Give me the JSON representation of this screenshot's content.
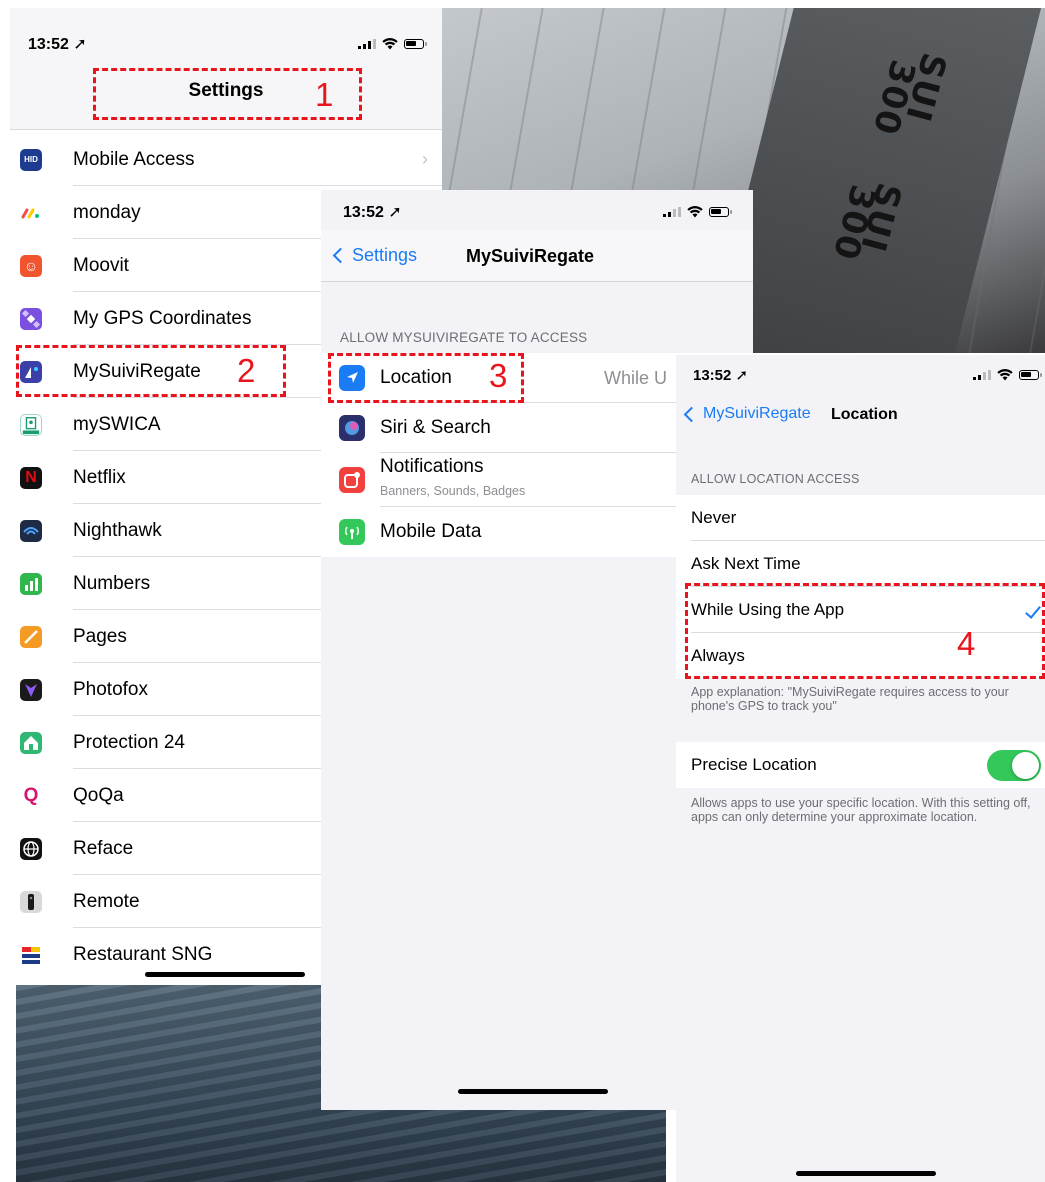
{
  "status_time": "13:52",
  "sail_numbers": [
    "SUI",
    "300",
    "SUI",
    "300"
  ],
  "settings_list": {
    "title": "Settings",
    "apps": [
      {
        "label": "Mobile Access",
        "icon": "hid-icon",
        "icon_text": "HID",
        "color": "#1d3c8f",
        "chevron": "›"
      },
      {
        "label": "monday",
        "icon": "monday-icon",
        "icon_text": "",
        "color": "#ffffff"
      },
      {
        "label": "Moovit",
        "icon": "moovit-icon",
        "icon_text": "☺",
        "color": "#f2542d"
      },
      {
        "label": "My GPS Coordinates",
        "icon": "satellite-icon",
        "icon_text": "",
        "color": "#7b4fe0"
      },
      {
        "label": "MySuiviRegate",
        "icon": "mysuiviregate-icon",
        "icon_text": "",
        "color": "#3d3fa8"
      },
      {
        "label": "mySWICA",
        "icon": "myswica-icon",
        "icon_text": "",
        "color": "#ffffff"
      },
      {
        "label": "Netflix",
        "icon": "netflix-icon",
        "icon_text": "N",
        "color": "#111111"
      },
      {
        "label": "Nighthawk",
        "icon": "nighthawk-icon",
        "icon_text": "",
        "color": "#1f2a44"
      },
      {
        "label": "Numbers",
        "icon": "numbers-icon",
        "icon_text": "",
        "color": "#2fb64c"
      },
      {
        "label": "Pages",
        "icon": "pages-icon",
        "icon_text": "",
        "color": "#f59a23"
      },
      {
        "label": "Photofox",
        "icon": "photofox-icon",
        "icon_text": "",
        "color": "#1a1a1a"
      },
      {
        "label": "Protection 24",
        "icon": "protection24-icon",
        "icon_text": "",
        "color": "#2fb873"
      },
      {
        "label": "QoQa",
        "icon": "qoqa-icon",
        "icon_text": "Q",
        "color": "#ffffff"
      },
      {
        "label": "Reface",
        "icon": "reface-icon",
        "icon_text": "",
        "color": "#111111"
      },
      {
        "label": "Remote",
        "icon": "remote-icon",
        "icon_text": "",
        "color": "#d9d9dc"
      },
      {
        "label": "Restaurant SNG",
        "icon": "restaurant-sng-icon",
        "icon_text": "",
        "color": "#1b3b86"
      }
    ]
  },
  "app_settings": {
    "back_label": "Settings",
    "title": "MySuiviRegate",
    "section_header": "ALLOW MYSUIVIREGATE TO ACCESS",
    "rows": [
      {
        "label": "Location",
        "value": "While U",
        "icon": "location-arrow-icon",
        "color": "#1a7cf5"
      },
      {
        "label": "Siri & Search",
        "icon": "siri-icon",
        "color": "#2b2f6b"
      },
      {
        "label": "Notifications",
        "sublabel": "Banners, Sounds, Badges",
        "icon": "notifications-icon",
        "color": "#f1403d"
      },
      {
        "label": "Mobile Data",
        "icon": "antenna-icon",
        "color": "#34c759"
      }
    ]
  },
  "location_settings": {
    "back_label": "MySuiviRegate",
    "title": "Location",
    "section_header": "ALLOW LOCATION ACCESS",
    "options": [
      "Never",
      "Ask Next Time",
      "While Using the App",
      "Always"
    ],
    "selected": "While Using the App",
    "explanation": "App explanation: \"MySuiviRegate requires access to your phone's GPS to track you\"",
    "precise_label": "Precise Location",
    "precise_on": true,
    "precise_note": "Allows apps to use your specific location. With this setting off, apps can only determine your approximate location."
  },
  "annotations": [
    "1",
    "2",
    "3",
    "4"
  ],
  "colors": {
    "ios_blue": "#1a7cf5",
    "annotation_red": "#e8161c",
    "toggle_green": "#34c759"
  }
}
